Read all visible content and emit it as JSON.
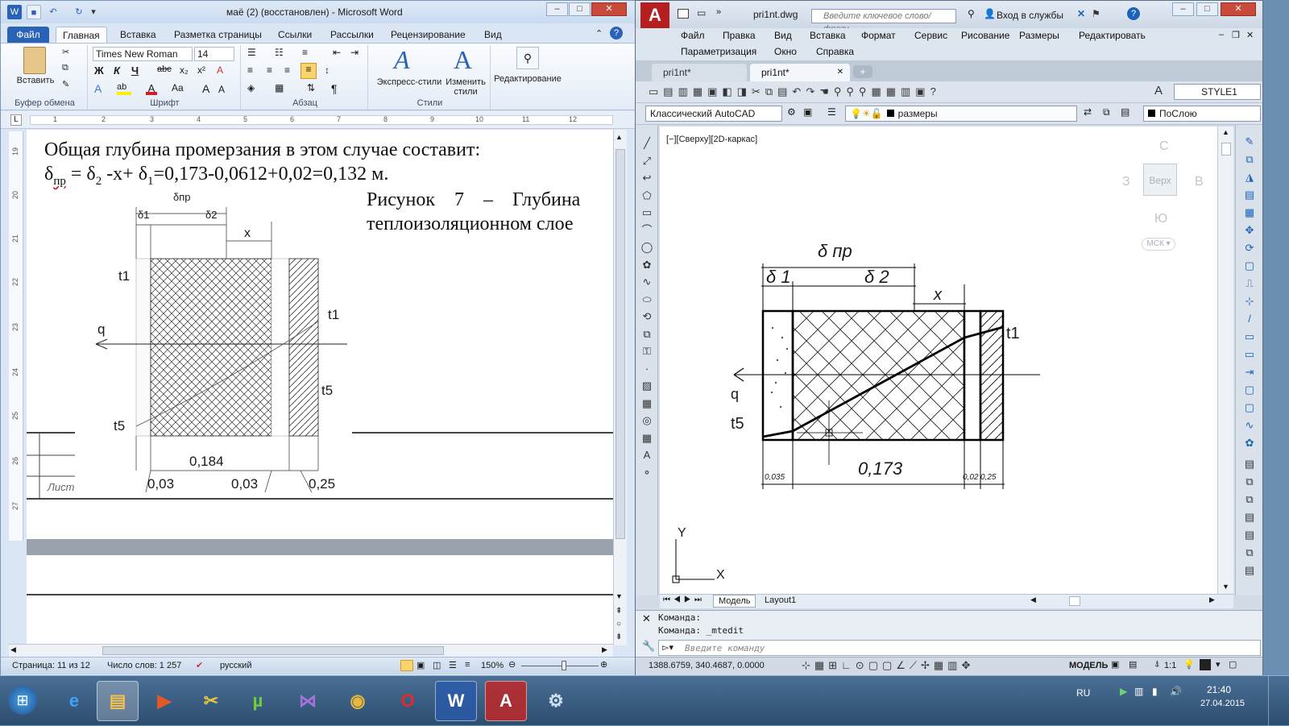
{
  "word": {
    "title": "маё (2) (восстановлен) - Microsoft Word",
    "tabs": [
      "Файл",
      "Главная",
      "Вставка",
      "Разметка страницы",
      "Ссылки",
      "Рассылки",
      "Рецензирование",
      "Вид"
    ],
    "ribbon": {
      "paste_label": "Вставить",
      "font_name": "Times New Roman",
      "font_size": "14",
      "groups": [
        "Буфер обмена",
        "Шрифт",
        "Абзац",
        "Стили"
      ],
      "express_styles": "Экспресс-стили",
      "change_styles": "Изменить стили",
      "editing": "Редактирование"
    },
    "ruler_marks": [
      "1",
      "2",
      "3",
      "4",
      "5",
      "6",
      "7",
      "8",
      "9",
      "10",
      "11",
      "12"
    ],
    "vruler_marks": [
      "19",
      "20",
      "21",
      "22",
      "23",
      "24",
      "25",
      "26",
      "27"
    ],
    "document": {
      "line1": "Общая глубина промерзания в этом случае составит:",
      "line2_lead": "δ",
      "line2_lead_sub": "пр",
      "line2_mid": " = δ",
      "line2_mid_sub": "2",
      "line2_mid2": " -x+ δ",
      "line2_mid2_sub": "1",
      "line2_tail": "=0,173-0,0612+0,02=0,132 м.",
      "caption_line1": "Рисунок 7 – Глубина",
      "caption_line2": "теплоизоляционном слое",
      "diagram": {
        "delta_pr": "δпр",
        "delta1": "δ1",
        "delta2": "δ2",
        "x": "x",
        "t1_top": "t1",
        "t1_right": "t1",
        "q": "q",
        "t5_right": "t5",
        "t5_left": "t5",
        "dim_0184": "0,184",
        "dim_003a": "0,03",
        "dim_003b": "0,03",
        "dim_025": "0,25"
      },
      "frame_label": "Лист"
    },
    "status": {
      "page": "Страница: 11 из 12",
      "words": "Число слов: 1 257",
      "lang": "русский",
      "zoom": "150%"
    }
  },
  "acad": {
    "file": "pri1nt.dwg",
    "search_placeholder": "Введите ключевое слово/фразу",
    "login": "Вход в службы",
    "menu_row1": [
      "Файл",
      "Правка",
      "Вид",
      "Вставка",
      "Формат",
      "Сервис",
      "Рисование",
      "Размеры",
      "Редактировать"
    ],
    "menu_row2": [
      "Параметризация",
      "Окно",
      "Справка"
    ],
    "tabs": [
      "pri1nt*",
      "pri1nt*"
    ],
    "style_combo": "STYLE1",
    "workspace": "Классический AutoCAD",
    "layer": "размеры",
    "linetype": "ПоСлою",
    "viewport_label": "[−][Сверху][2D-каркас]",
    "viewcube": {
      "n": "С",
      "w": "З",
      "e": "В",
      "s": "Ю",
      "top": "Верх",
      "ucs": "МСК"
    },
    "drawing": {
      "delta_pr": "δ пр",
      "delta1": "δ 1",
      "delta2": "δ 2",
      "x": "x",
      "t1": "t1",
      "q": "q",
      "t5": "t5",
      "dim_0035": "0,035",
      "dim_0173": "0,173",
      "dim_002": "0,02",
      "dim_025": "0,25",
      "axis_y": "Y",
      "axis_x": "X"
    },
    "layout_tabs": [
      "Модель",
      "Layout1"
    ],
    "cmd_history": [
      "Команда:",
      "Команда: _mtedit"
    ],
    "cmd_placeholder": "Введите команду",
    "coords": "1388.6759, 340.4687, 0.0000",
    "model_label": "МОДЕЛЬ",
    "scale": "1:1"
  },
  "taskbar": {
    "lang": "RU",
    "time": "21:40",
    "date": "27.04.2015"
  }
}
